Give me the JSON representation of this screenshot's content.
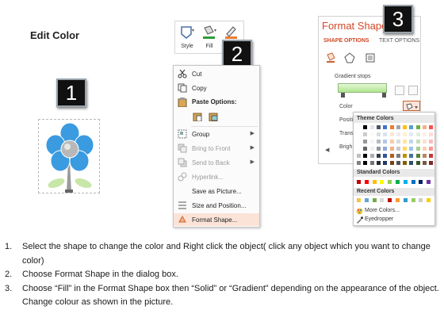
{
  "title": "Edit Color",
  "badges": [
    "1",
    "2",
    "3"
  ],
  "ribbon": {
    "style_label": "Style",
    "fill_label": "Fill",
    "outline_label": "O"
  },
  "context_menu": {
    "items": [
      {
        "label": "Cut",
        "disabled": false
      },
      {
        "label": "Copy",
        "disabled": false
      },
      {
        "label": "Paste Options:",
        "disabled": false
      },
      {
        "label": "Group",
        "disabled": false
      },
      {
        "label": "Bring to Front",
        "disabled": true
      },
      {
        "label": "Send to Back",
        "disabled": true
      },
      {
        "label": "Hyperlink...",
        "disabled": true
      },
      {
        "label": "Save as Picture...",
        "disabled": false
      },
      {
        "label": "Size and Position...",
        "disabled": false
      },
      {
        "label": "Format Shape...",
        "disabled": false
      }
    ]
  },
  "format_panel": {
    "title": "Format Shape",
    "tab_shape": "SHAPE OPTIONS",
    "tab_text": "TEXT OPTIONS",
    "gradient_stops": "Gradient stops",
    "color_label": "Color",
    "position_label": "Positi",
    "transparency_label": "Trans",
    "brightness_label": "Brigh"
  },
  "color_dropdown": {
    "theme_colors": "Theme Colors",
    "standard_colors": "Standard Colors",
    "recent_colors": "Recent Colors",
    "more_colors": "More Colors...",
    "eyedropper": "Eyedropper",
    "theme_palette": [
      "#ffffff",
      "#000000",
      "#e7e6e6",
      "#44546a",
      "#4472c4",
      "#ed7d31",
      "#a5a5a5",
      "#ffc000",
      "#5b9bd5",
      "#70ad47",
      "#f4b183",
      "#ff5050"
    ],
    "standard_palette": [
      "#c00000",
      "#ff0000",
      "#ffc000",
      "#ffff00",
      "#92d050",
      "#00b050",
      "#00b0f0",
      "#0070c0",
      "#002060",
      "#7030a0"
    ],
    "recent_palette": [
      "#f4c542",
      "#5fa8d3",
      "#70ad47",
      "#d9d9d9",
      "#c00000",
      "#ff9933",
      "#3399cc",
      "#99cc66",
      "#cccccc",
      "#ffcc00"
    ]
  },
  "instructions": [
    {
      "num": "1.",
      "text": "Select the shape to change the color and Right click the object( click any object which you want to change color)"
    },
    {
      "num": "2.",
      "text": "Choose Format Shape in the dialog box."
    },
    {
      "num": "3.",
      "text": "Choose “Fill” in the Format Shape box then “Solid” or “Gradient” depending on the appearance of the object. Change colour as shown in the picture."
    }
  ],
  "colors": {
    "accent": "#d24726",
    "flower_petal": "#3a9be0",
    "flower_center": "#a9a9a9",
    "leaf": "#8cc63f"
  }
}
